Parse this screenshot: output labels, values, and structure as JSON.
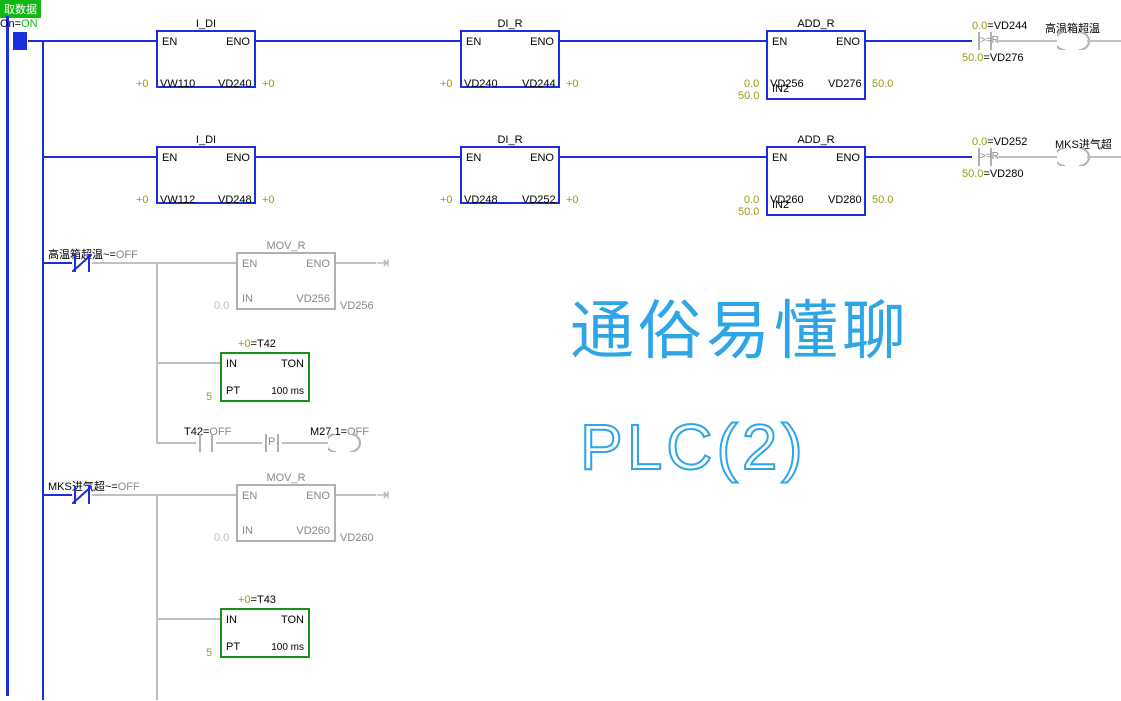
{
  "header": {
    "label": "取数据"
  },
  "overlay": {
    "title": "通俗易懂聊",
    "subtitle": "PLC(2)"
  },
  "rung1": {
    "startLabel": "On=",
    "startState": "ON",
    "block1": {
      "title": "I_DI",
      "en": "EN",
      "eno": "ENO",
      "in_val": "+0",
      "in_addr": "VW110",
      "out_addr": "VD240",
      "out_val": "+0"
    },
    "block2": {
      "title": "DI_R",
      "en": "EN",
      "eno": "ENO",
      "in_val": "+0",
      "in_addr": "VD240",
      "out_addr": "VD244",
      "out_val": "+0"
    },
    "block3": {
      "title": "ADD_R",
      "en": "EN",
      "eno": "ENO",
      "in1_val": "0.0",
      "in1_addr": "VD256",
      "in2_val": "50.0",
      "in2_label": "IN2",
      "out_addr": "VD276",
      "out_val": "50.0"
    },
    "compare": {
      "top_val": "0.0",
      "top_addr": "=VD244",
      "op": ">=R",
      "bot_val": "50.0",
      "bot_addr": "=VD276"
    },
    "coil_label": "高温箱超温"
  },
  "rung2": {
    "block1": {
      "title": "I_DI",
      "en": "EN",
      "eno": "ENO",
      "in_val": "+0",
      "in_addr": "VW112",
      "out_addr": "VD248",
      "out_val": "+0"
    },
    "block2": {
      "title": "DI_R",
      "en": "EN",
      "eno": "ENO",
      "in_val": "+0",
      "in_addr": "VD248",
      "out_addr": "VD252",
      "out_val": "+0"
    },
    "block3": {
      "title": "ADD_R",
      "en": "EN",
      "eno": "ENO",
      "in1_val": "0.0",
      "in1_addr": "VD260",
      "in2_val": "50.0",
      "in2_label": "IN2",
      "out_addr": "VD280",
      "out_val": "50.0"
    },
    "compare": {
      "top_val": "0.0",
      "top_addr": "=VD252",
      "bot_val": "50.0",
      "bot_addr": "=VD280"
    },
    "coil_label": "MKS进气超"
  },
  "rung3": {
    "label": "高温箱超温~=",
    "state": "OFF",
    "mov": {
      "title": "MOV_R",
      "en": "EN",
      "eno": "ENO",
      "in_val": "0.0",
      "in_label": "IN",
      "out_addr": "VD256",
      "out_faded": "VD256"
    },
    "timer": {
      "title_val": "+0",
      "title_addr": "=T42",
      "in_label": "IN",
      "ton": "TON",
      "pt_val": "5",
      "pt_label": "PT",
      "time": "100 ms"
    },
    "midrow": {
      "t42_label": "T42=",
      "t42_state": "OFF",
      "p": "P",
      "coil_label": "M27.1=",
      "coil_state": "OFF"
    }
  },
  "rung4": {
    "label": "MKS进气超~=",
    "state": "OFF",
    "mov": {
      "title": "MOV_R",
      "en": "EN",
      "eno": "ENO",
      "in_val": "0.0",
      "in_label": "IN",
      "out_addr": "VD260",
      "out_faded": "VD260"
    },
    "timer": {
      "title_val": "+0",
      "title_addr": "=T43",
      "in_label": "IN",
      "ton": "TON",
      "pt_val": "5",
      "pt_label": "PT",
      "time": "100 ms"
    }
  }
}
